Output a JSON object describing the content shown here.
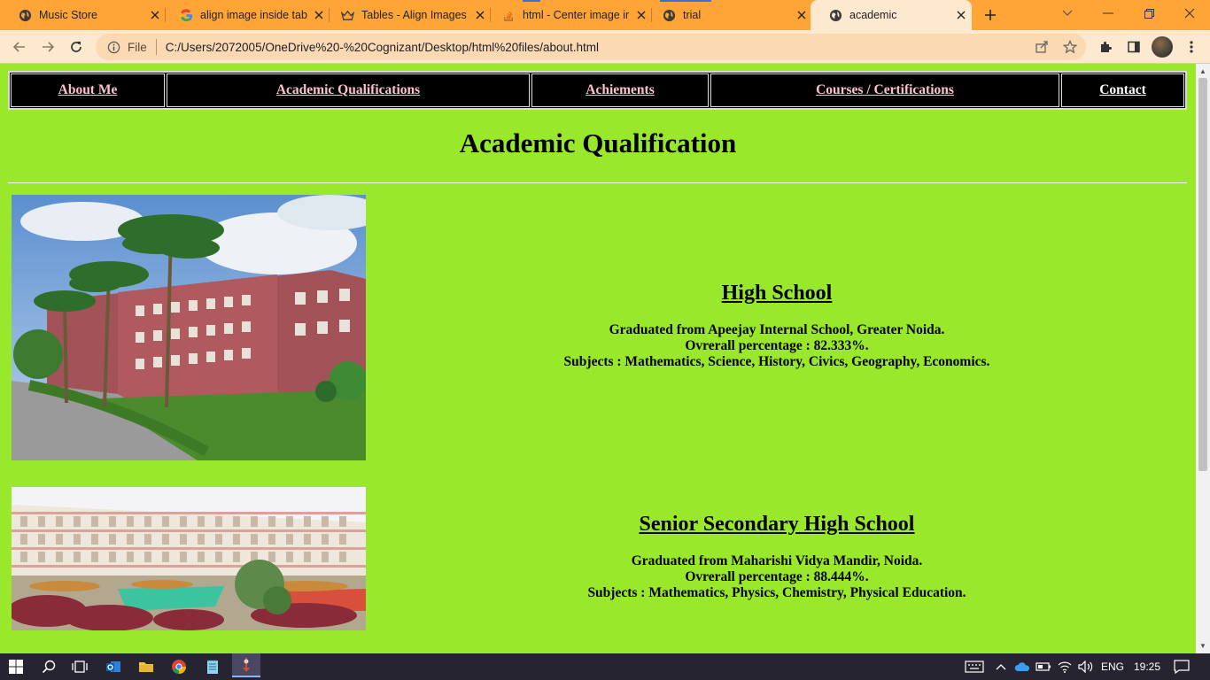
{
  "browser": {
    "tabs": [
      {
        "label": "Music Store",
        "icon": "globe-icon"
      },
      {
        "label": "align image inside tab",
        "icon": "google-icon"
      },
      {
        "label": "Tables - Align Images",
        "icon": "crown-icon"
      },
      {
        "label": "html - Center image ir",
        "icon": "stackoverflow-icon"
      },
      {
        "label": "trial",
        "icon": "globe-icon"
      },
      {
        "label": "academic",
        "icon": "globe-icon",
        "active": true
      }
    ],
    "omnibox": {
      "scheme_label": "File",
      "url": "C:/Users/2072005/OneDrive%20-%20Cognizant/Desktop/html%20files/about.html"
    }
  },
  "page": {
    "nav": [
      {
        "label": "About Me"
      },
      {
        "label": "Academic Qualifications"
      },
      {
        "label": "Achiements"
      },
      {
        "label": "Courses / Certifications"
      },
      {
        "label": "Contact"
      }
    ],
    "title": "Academic Qualification",
    "sections": [
      {
        "heading": "High School",
        "lines": [
          "Graduated from Apeejay Internal School, Greater Noida.",
          "Ovrerall percentage : 82.333%.",
          "Subjects : Mathematics, Science, History, Civics, Geography, Economics."
        ]
      },
      {
        "heading": "Senior Secondary High School",
        "lines": [
          "Graduated from Maharishi Vidya Mandir, Noida.",
          "Ovrerall percentage : 88.444%.",
          "Subjects : Mathematics, Physics, Chemistry, Physical Education."
        ]
      }
    ]
  },
  "taskbar": {
    "language": "ENG",
    "time": "19:25"
  },
  "colors": {
    "tabbar": "#ffa538",
    "toolbar": "#fde8d0",
    "page_background": "#9ae82b",
    "nav_background": "#000000",
    "nav_link": "#ffc0cb",
    "taskbar": "#262431"
  }
}
